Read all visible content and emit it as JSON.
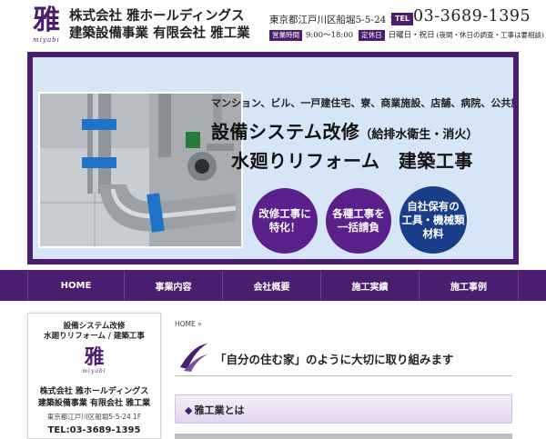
{
  "header": {
    "logo_kanji": "雅",
    "logo_roman": "miyabi",
    "company_line1": "株式会社 雅ホールディングス",
    "company_line2": "建築設備事業 有限会社 雅工業",
    "address": "東京都江戸川区船堀5-5-24 1F",
    "tel_label": "TEL",
    "tel_number": "03-3689-1395",
    "hours_label": "営業時間",
    "hours_value": "9:00～18:00",
    "holiday_label": "定休日",
    "holiday_value": "日曜日・祝日",
    "holiday_note": "(夜間・休日の調査・工事は要相談)"
  },
  "hero": {
    "subtitle": "マンション、ビル、一戸建住宅、寮、商業施設、店舗、病院、公共施設などの",
    "title1_main": "設備システム改修",
    "title1_paren": "（給排水衛生・消火）",
    "title2": "水廻りリフォーム　建築工事",
    "circles": [
      {
        "line1": "改修工事に",
        "line2": "特化！",
        "line3": ""
      },
      {
        "line1": "各種工事を",
        "line2": "一括請負",
        "line3": ""
      },
      {
        "line1": "自社保有の",
        "line2": "工具・機械類",
        "line3": "材料"
      }
    ],
    "colors": {
      "frame": "#4a1d6e",
      "background": "#d7e6f7",
      "circle_purple": "#5a1f8a",
      "circle_blue": "#1a3d8a"
    }
  },
  "nav": {
    "items": [
      {
        "label": "HOME"
      },
      {
        "label": "事業内容"
      },
      {
        "label": "会社概要"
      },
      {
        "label": "施工実績"
      },
      {
        "label": "施工事例"
      }
    ]
  },
  "sidebar": {
    "line1": "設備システム改修",
    "line2": "水廻りリフォーム / 建築工事",
    "logo_kanji": "雅",
    "logo_roman": "miyabi",
    "company1": "株式会社 雅ホールディングス",
    "company2": "建築設備事業 有限会社 雅工業",
    "address": "東京都江戸川区船堀5-5-24 1F",
    "tel": "TEL:03-3689-1395"
  },
  "main": {
    "breadcrumb": "HOME »",
    "section_title": "「自分の住む家」のように大切に取り組みます",
    "sub_title": "雅工業とは",
    "sub_title_marker": "◆"
  }
}
